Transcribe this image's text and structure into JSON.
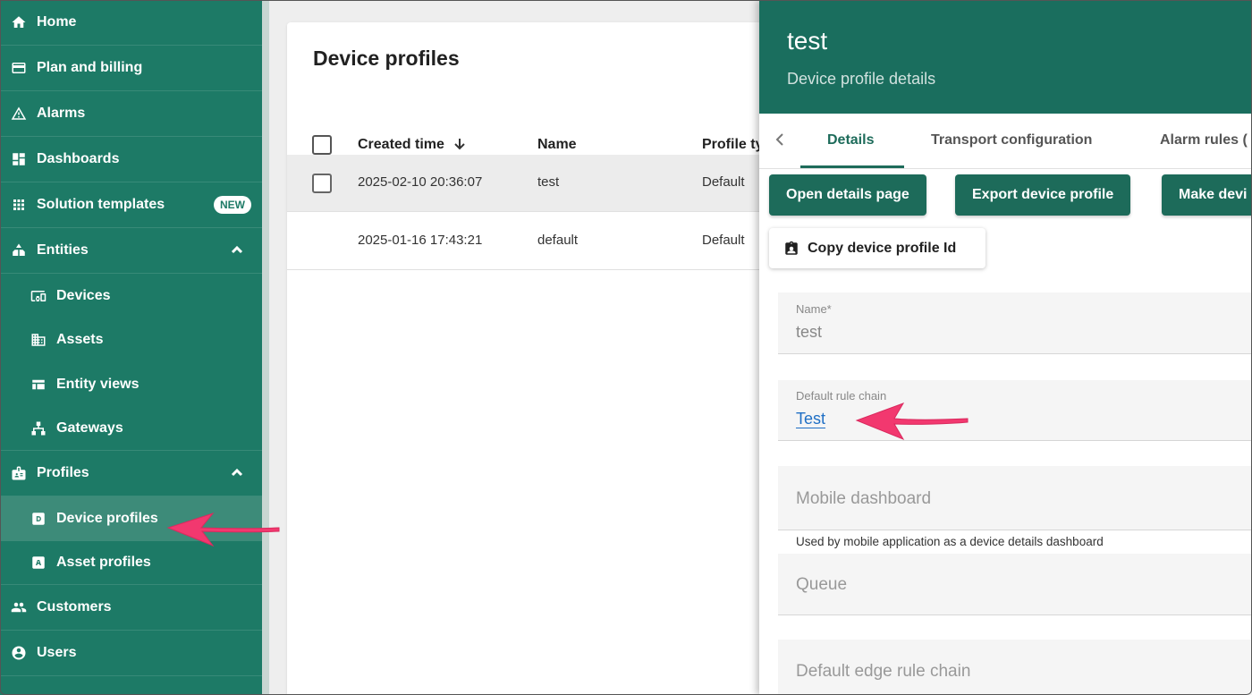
{
  "sidebar": {
    "items": [
      {
        "label": "Home",
        "icon": "home-icon"
      },
      {
        "label": "Plan and billing",
        "icon": "billing-icon"
      },
      {
        "label": "Alarms",
        "icon": "alarm-warning-icon"
      },
      {
        "label": "Dashboards",
        "icon": "dashboard-icon"
      },
      {
        "label": "Solution templates",
        "icon": "apps-grid-icon",
        "badge": "NEW"
      },
      {
        "label": "Entities",
        "icon": "entities-icon",
        "expanded": true
      },
      {
        "label": "Devices",
        "icon": "devices-icon"
      },
      {
        "label": "Assets",
        "icon": "assets-icon"
      },
      {
        "label": "Entity views",
        "icon": "entity-views-icon"
      },
      {
        "label": "Gateways",
        "icon": "gateway-icon"
      },
      {
        "label": "Profiles",
        "icon": "profiles-icon",
        "expanded": true
      },
      {
        "label": "Device profiles",
        "icon": "device-profile-icon",
        "active": true
      },
      {
        "label": "Asset profiles",
        "icon": "asset-profile-icon"
      },
      {
        "label": "Customers",
        "icon": "customers-icon"
      },
      {
        "label": "Users",
        "icon": "users-icon"
      }
    ]
  },
  "list": {
    "title": "Device profiles",
    "columns": [
      "Created time",
      "Name",
      "Profile ty"
    ],
    "sort_icon": "arrow-down-icon",
    "rows": [
      {
        "created": "2025-02-10 20:36:07",
        "name": "test",
        "type": "Default",
        "selected": true
      },
      {
        "created": "2025-01-16 17:43:21",
        "name": "default",
        "type": "Default",
        "selected": false
      }
    ]
  },
  "panel": {
    "title": "test",
    "subtitle": "Device profile details",
    "tabs": [
      "Details",
      "Transport configuration",
      "Alarm rules ("
    ],
    "active_tab": "Details",
    "buttons": {
      "open_details": "Open details page",
      "export": "Export device profile",
      "make_default": "Make devi",
      "copy_id": "Copy device profile Id"
    },
    "fields": {
      "name_label": "Name*",
      "name_value": "test",
      "rule_chain_label": "Default rule chain",
      "rule_chain_value": "Test",
      "mobile_dashboard_placeholder": "Mobile dashboard",
      "mobile_dashboard_hint": "Used by mobile application as a device details dashboard",
      "queue_placeholder": "Queue",
      "edge_rule_chain_placeholder": "Default edge rule chain"
    }
  },
  "colors": {
    "sidebar_bg": "#1d7a66",
    "header_bg": "#1a6e5e",
    "accent": "#1d6b5a",
    "link": "#1f6fc5",
    "annotation_arrow": "#f2386f"
  }
}
